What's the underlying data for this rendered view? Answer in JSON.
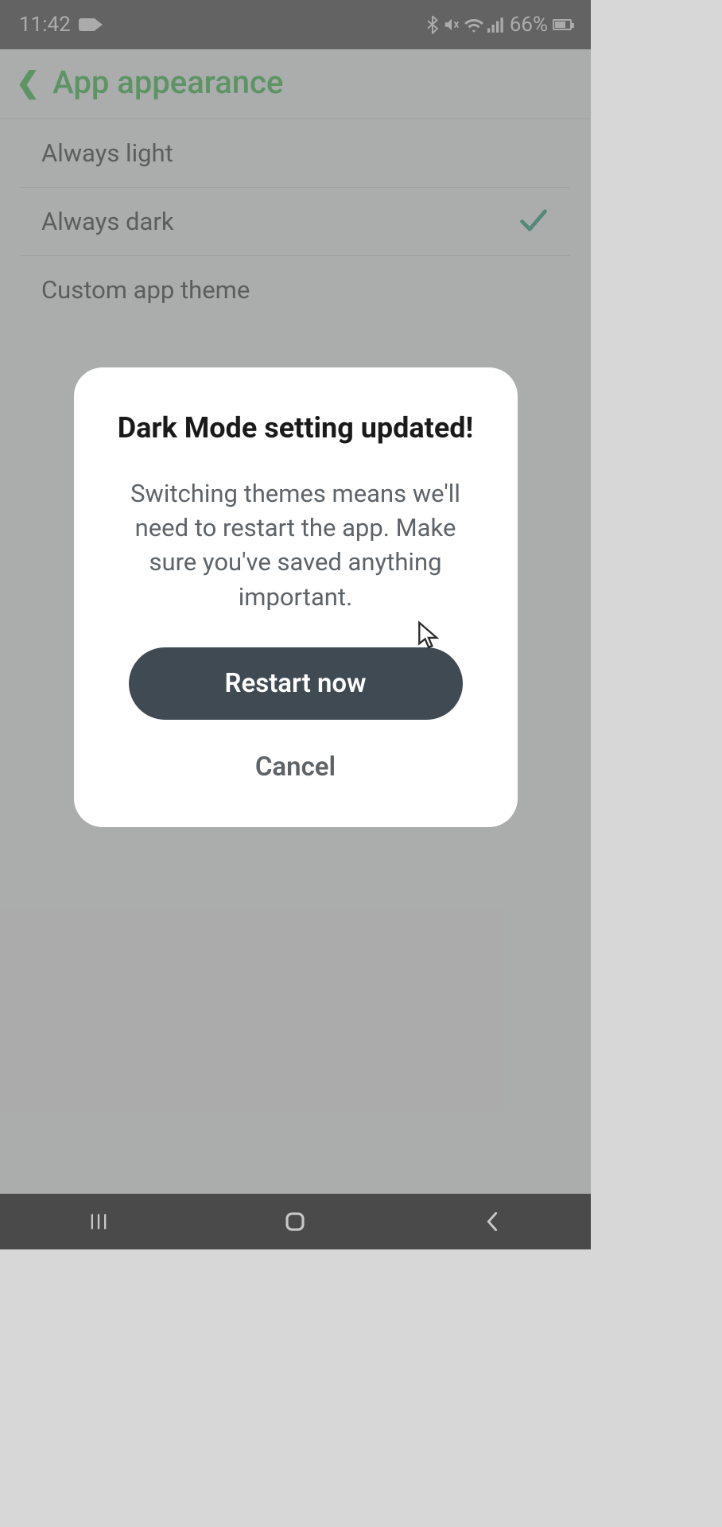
{
  "statusbar": {
    "time": "11:42",
    "battery_text": "66%"
  },
  "header": {
    "title": "App appearance"
  },
  "options": {
    "light": "Always light",
    "dark": "Always dark",
    "custom": "Custom app theme",
    "selected": "dark"
  },
  "modal": {
    "title": "Dark Mode setting updated!",
    "body": "Switching themes means we'll need to restart the app. Make sure you've saved anything important.",
    "primary": "Restart now",
    "secondary": "Cancel"
  }
}
